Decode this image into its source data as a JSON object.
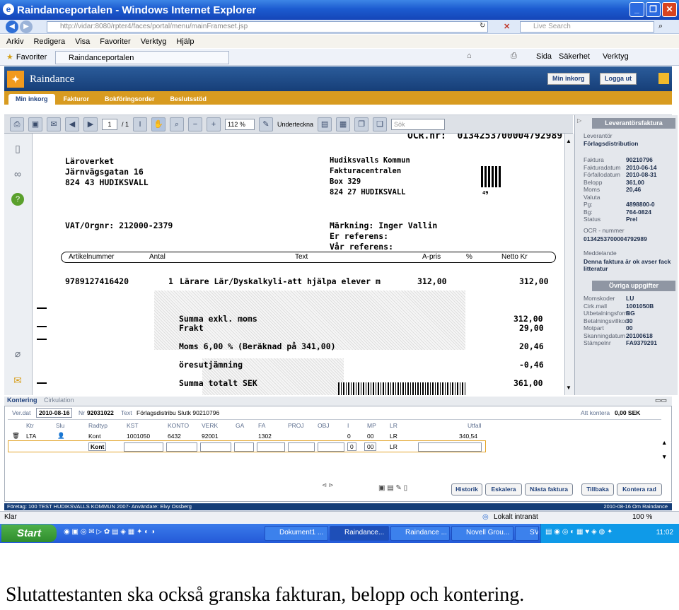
{
  "window": {
    "title": "Raindanceportalen - Windows Internet Explorer"
  },
  "address": {
    "url": "http://vidar:8080/rpter4/faces/portal/menu/mainFrameset.jsp",
    "search_placeholder": "Live Search"
  },
  "menubar": [
    "Arkiv",
    "Redigera",
    "Visa",
    "Favoriter",
    "Verktyg",
    "Hjälp"
  ],
  "favbar": {
    "favorites": "Favoriter",
    "tab": "Raindanceportalen",
    "tools": [
      "Sida",
      "Säkerhet",
      "Verktyg"
    ]
  },
  "app": {
    "title": "Raindance",
    "header_buttons": [
      "Min inkorg",
      "Logga ut"
    ],
    "tabs": [
      "Min inkorg",
      "Fakturor",
      "Bokföringsorder",
      "Beslutsstöd"
    ]
  },
  "pdf_toolbar": {
    "page": "1",
    "page_total": "/ 1",
    "zoom": "112 %",
    "sign": "Underteckna",
    "search_placeholder": "Sök"
  },
  "invoice": {
    "top_line": "OCR.nr:  0134253700004792989",
    "sender": [
      "Läroverket",
      "Järnvägsgatan 16",
      "824 43 HUDIKSVALL"
    ],
    "recipient": [
      "Hudiksvalls Kommun",
      "Fakturacentralen",
      "Box 329",
      "824 27 HUDIKSVALL"
    ],
    "qr_label": "49",
    "vat": "VAT/Orgnr: 212000-2379",
    "marking": [
      "Märkning: Inger Vallin",
      "Er referens:",
      "Vår referens:"
    ],
    "columns": [
      "Artikelnummer",
      "Antal",
      "Text",
      "A-pris",
      "%",
      "Netto Kr"
    ],
    "line": {
      "article": "9789127416420",
      "qty": "1",
      "text": "Lärare Lär/Dyskalkyli-att hjälpa elever m",
      "price": "312,00",
      "net": "312,00"
    },
    "sums": [
      {
        "label": "Summa exkl. moms",
        "value": "312,00"
      },
      {
        "label": "Frakt",
        "value": "29,00"
      },
      {
        "label": "Moms 6,00 % (Beräknad på 341,00)",
        "value": "20,46"
      },
      {
        "label": "öresutjämning",
        "value": "-0,46"
      },
      {
        "label": "Summa totalt SEK",
        "value": "361,00"
      }
    ]
  },
  "right_panel": {
    "header": "Leverantörsfaktura",
    "leverantor_label": "Leverantör",
    "leverantor_value": "Förlagsdistribution",
    "fields": [
      {
        "label": "Faktura",
        "value": "90210796"
      },
      {
        "label": "Fakturadatum",
        "value": "2010-06-14"
      },
      {
        "label": "Förfallodatum",
        "value": "2010-08-31"
      },
      {
        "label": "Belopp",
        "value": "361,00"
      },
      {
        "label": "Moms",
        "value": "20,46"
      },
      {
        "label": "Valuta",
        "value": ""
      },
      {
        "label": "Pg:",
        "value": "4898800-0"
      },
      {
        "label": "Bg:",
        "value": "764-0824"
      },
      {
        "label": "Status",
        "value": "Prel"
      }
    ],
    "ocr_label": "OCR - nummer",
    "ocr_value": "0134253700004792989",
    "message_label": "Meddelande",
    "message_value": "Denna faktura är ok avser fack litteratur",
    "other_header": "Övriga uppgifter",
    "other_fields": [
      {
        "label": "Momskoder",
        "value": "LU"
      },
      {
        "label": "Cirk.mall",
        "value": "1001050B"
      },
      {
        "label": "Utbetalningsform",
        "value": "BG"
      },
      {
        "label": "Betalningsvillkor",
        "value": "30"
      },
      {
        "label": "Motpart",
        "value": "00"
      },
      {
        "label": "Skanningdatum",
        "value": "20100618"
      },
      {
        "label": "Stämpelnr",
        "value": "FA9379291"
      }
    ]
  },
  "kontering": {
    "tabs": [
      "Kontering",
      "Cirkulation"
    ],
    "verdat_label": "Ver.dat",
    "verdat": "2010-08-16",
    "nr_label": "Nr",
    "nr": "92031022",
    "text_label": "Text",
    "text": "Förlagsdistribu Slutk 90210796",
    "att_kontera_label": "Att kontera",
    "att_kontera": "0,00 SEK",
    "columns": [
      "Ktr",
      "Slu",
      "Radtyp",
      "KST",
      "KONTO",
      "VERK",
      "GA",
      "FA",
      "PROJ",
      "OBJ",
      "I",
      "MP",
      "LR",
      "Utfall"
    ],
    "row": {
      "ktr": "LTA",
      "radtyp": "Kont",
      "kst": "1001050",
      "konto": "6432",
      "verk": "92001",
      "fa": "1302",
      "i": "0",
      "mp": "00",
      "lr": "LR",
      "utfall": "340,54"
    },
    "new_row": {
      "radtyp": "Kont",
      "i": "0",
      "mp": "00",
      "lr": "LR"
    },
    "buttons": [
      "Historik",
      "Eskalera",
      "Nästa faktura",
      "Tillbaka",
      "Kontera rad"
    ]
  },
  "app_status": {
    "left": "Företag: 100 TEST HUDIKSVALLS KOMMUN 2007-   Användare: Elvy Ossberg",
    "right": "2010-08-16  Om Raindance"
  },
  "ie_status": {
    "left": "Klar",
    "zone": "Lokalt intranät",
    "zoom": "100 %"
  },
  "taskbar": {
    "start": "Start",
    "items": [
      "Dokument1 ...",
      "Raindance...",
      "Raindance ...",
      "Novell Grou...",
      "SV"
    ],
    "time": "11:02"
  },
  "caption": "Slutattestanten ska också granska fakturan, belopp och kontering."
}
